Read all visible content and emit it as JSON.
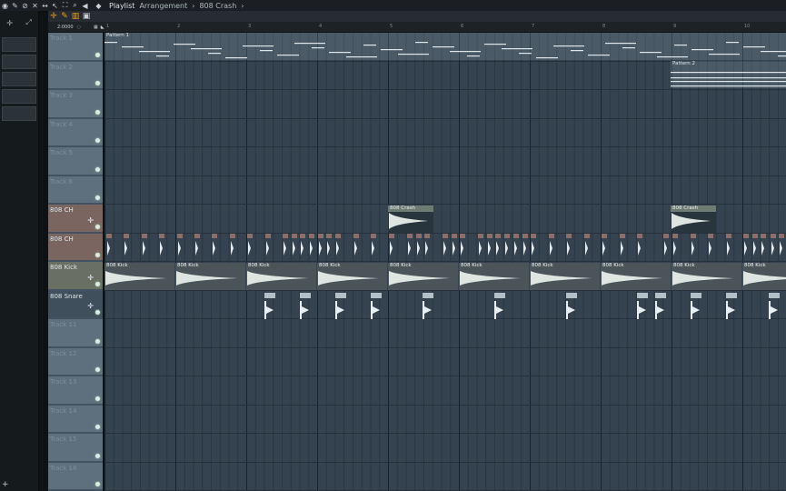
{
  "titlebar": {
    "icons": [
      "record-icon",
      "pencil-icon",
      "slash-icon",
      "mute-icon",
      "move-icon",
      "pointer-icon",
      "scale-icon",
      "magnify-icon",
      "speaker-icon",
      "play-icon"
    ],
    "title": "Playlist",
    "breadcrumbs": [
      "Arrangement",
      "808 Crash"
    ]
  },
  "tempo_text": "2:0000",
  "ruler_ticks": [
    "1",
    "2",
    "3",
    "4",
    "5",
    "6",
    "7",
    "8",
    "9",
    "10"
  ],
  "tracks": [
    {
      "name": "Track 1",
      "style": "normal"
    },
    {
      "name": "Track 2",
      "style": "normal"
    },
    {
      "name": "Track 3",
      "style": "normal"
    },
    {
      "name": "Track 4",
      "style": "normal"
    },
    {
      "name": "Track 5",
      "style": "normal"
    },
    {
      "name": "Track 6",
      "style": "normal"
    },
    {
      "name": "808 CH",
      "style": "ch"
    },
    {
      "name": "808 CH",
      "style": "ch"
    },
    {
      "name": "808 Kick",
      "style": "kick"
    },
    {
      "name": "808 Snare",
      "style": "snare"
    },
    {
      "name": "Track 11",
      "style": "normal"
    },
    {
      "name": "Track 12",
      "style": "normal"
    },
    {
      "name": "Track 13",
      "style": "normal"
    },
    {
      "name": "Track 14",
      "style": "normal"
    },
    {
      "name": "Track 15",
      "style": "normal"
    },
    {
      "name": "Track 16",
      "style": "normal"
    }
  ],
  "clips": {
    "pattern1": "Pattern 1",
    "pattern2": "Pattern 2",
    "crash": "808 Crash",
    "kick": "808 Kick"
  },
  "colors": {
    "grid": "#34434f",
    "accent": "#f0a020",
    "ch_track": "#7a6561",
    "kick_track": "#6a6f63"
  }
}
